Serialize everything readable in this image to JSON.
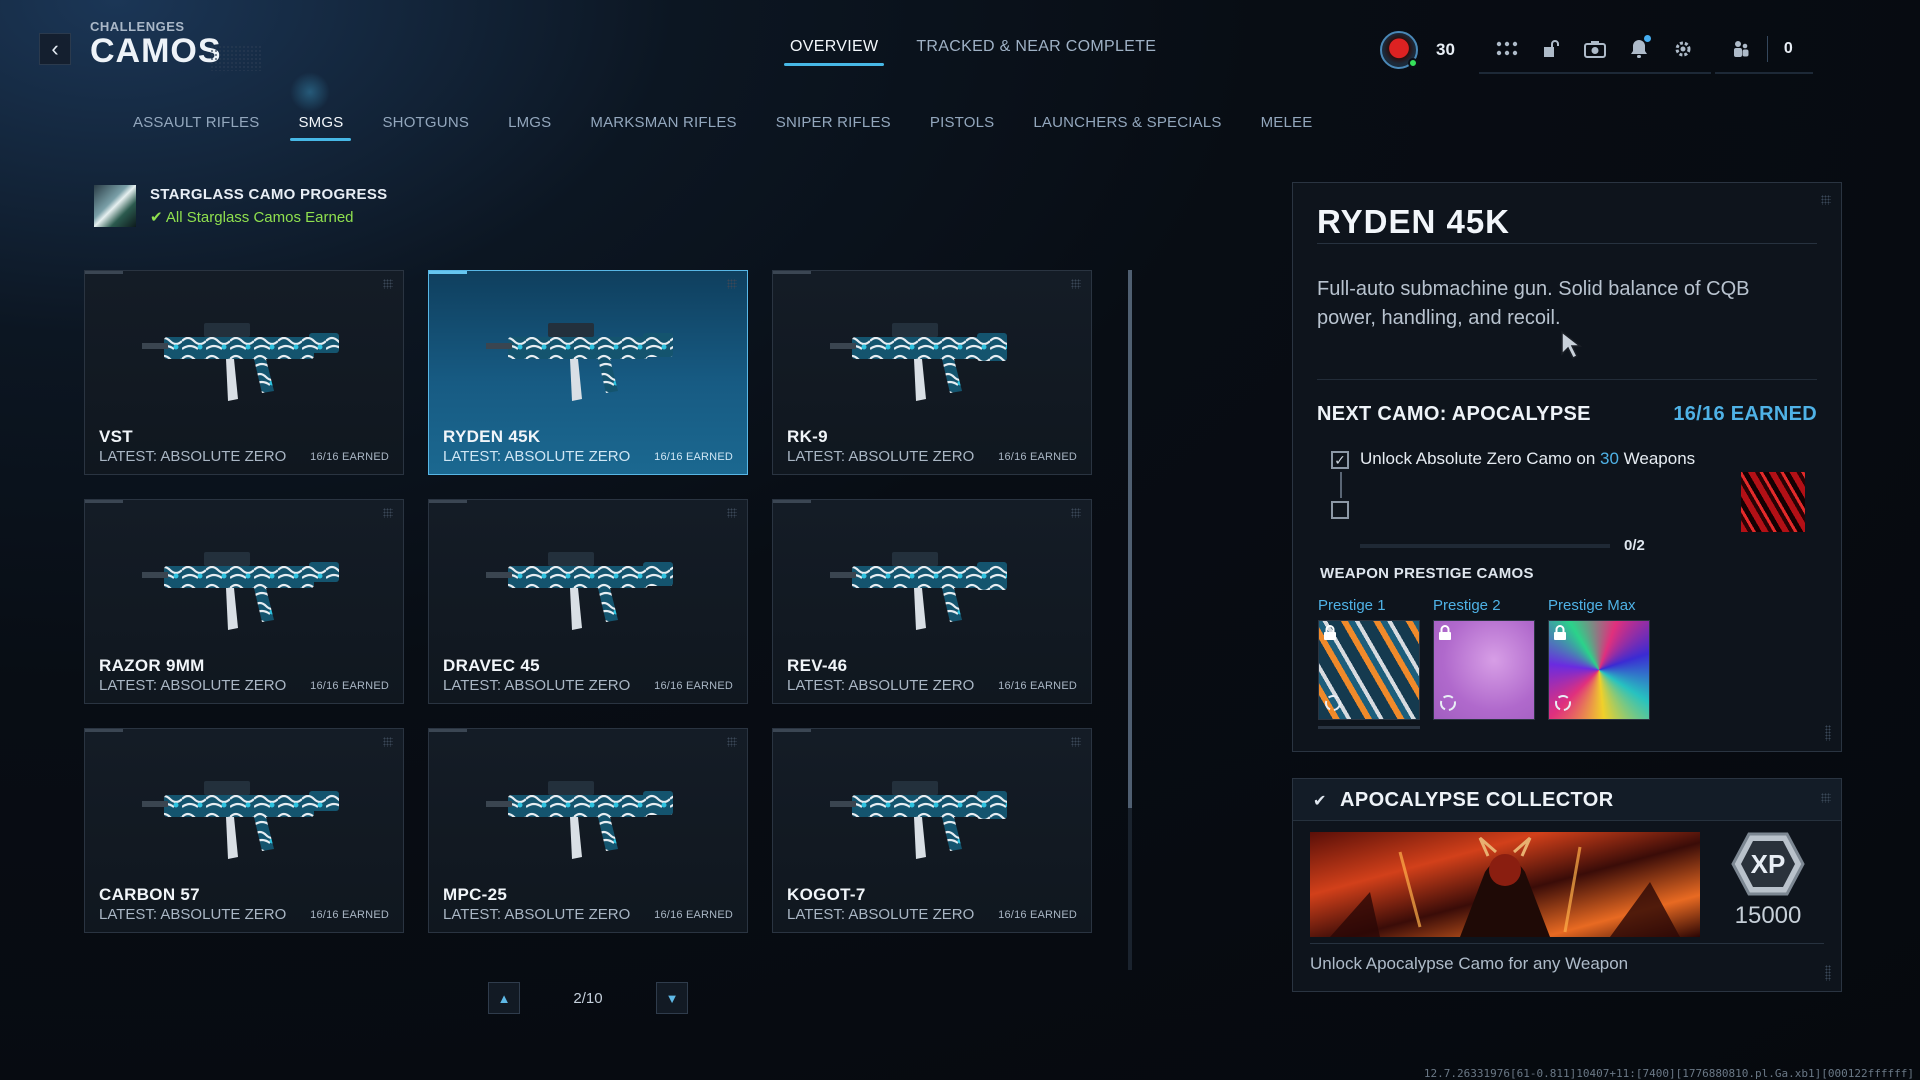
{
  "header": {
    "breadcrumb": "CHALLENGES",
    "title": "CAMOS",
    "top_tabs": [
      {
        "label": "OVERVIEW",
        "active": true
      },
      {
        "label": "TRACKED & NEAR COMPLETE",
        "active": false
      }
    ],
    "level": "30",
    "friends_count": "0",
    "icons": [
      "apps-grid-icon",
      "locker-icon",
      "camera-icon",
      "bell-icon",
      "gear-icon"
    ]
  },
  "categories": [
    {
      "label": "ASSAULT RIFLES",
      "active": false
    },
    {
      "label": "SMGS",
      "active": true
    },
    {
      "label": "SHOTGUNS",
      "active": false
    },
    {
      "label": "LMGS",
      "active": false
    },
    {
      "label": "MARKSMAN RIFLES",
      "active": false
    },
    {
      "label": "SNIPER RIFLES",
      "active": false
    },
    {
      "label": "PISTOLS",
      "active": false
    },
    {
      "label": "LAUNCHERS & SPECIALS",
      "active": false
    },
    {
      "label": "MELEE",
      "active": false
    }
  ],
  "starglass": {
    "title": "STARGLASS CAMO PROGRESS",
    "status": "All Starglass Camos Earned"
  },
  "weapons": [
    {
      "name": "VST",
      "latest": "LATEST: ABSOLUTE ZERO",
      "earned": "16/16 EARNED",
      "selected": false
    },
    {
      "name": "RYDEN 45K",
      "latest": "LATEST: ABSOLUTE ZERO",
      "earned": "16/16 EARNED",
      "selected": true
    },
    {
      "name": "RK-9",
      "latest": "LATEST: ABSOLUTE ZERO",
      "earned": "16/16 EARNED",
      "selected": false
    },
    {
      "name": "RAZOR 9MM",
      "latest": "LATEST: ABSOLUTE ZERO",
      "earned": "16/16 EARNED",
      "selected": false
    },
    {
      "name": "DRAVEC 45",
      "latest": "LATEST: ABSOLUTE ZERO",
      "earned": "16/16 EARNED",
      "selected": false
    },
    {
      "name": "REV-46",
      "latest": "LATEST: ABSOLUTE ZERO",
      "earned": "16/16 EARNED",
      "selected": false
    },
    {
      "name": "CARBON 57",
      "latest": "LATEST: ABSOLUTE ZERO",
      "earned": "16/16 EARNED",
      "selected": false
    },
    {
      "name": "MPC-25",
      "latest": "LATEST: ABSOLUTE ZERO",
      "earned": "16/16 EARNED",
      "selected": false
    },
    {
      "name": "KOGOT-7",
      "latest": "LATEST: ABSOLUTE ZERO",
      "earned": "16/16 EARNED",
      "selected": false
    }
  ],
  "pager": {
    "text": "2/10"
  },
  "detail": {
    "title": "RYDEN 45K",
    "description": "Full-auto submachine gun. Solid balance of CQB power, handling, and recoil.",
    "next_camo": "NEXT CAMO: APOCALYPSE",
    "earned": "16/16 EARNED",
    "requirement": {
      "prefix": "Unlock Absolute Zero Camo on ",
      "highlight": "30",
      "suffix": " Weapons",
      "checked": true
    },
    "progress": {
      "label": "0/2",
      "fraction": 0.0
    },
    "prestige_heading": "WEAPON PRESTIGE CAMOS",
    "prestige": [
      {
        "label": "Prestige 1",
        "locked": true
      },
      {
        "label": "Prestige 2",
        "locked": true
      },
      {
        "label": "Prestige Max",
        "locked": true
      }
    ]
  },
  "collector": {
    "title": "APOCALYPSE COLLECTOR",
    "xp_badge": "XP",
    "xp_value": "15000",
    "description": "Unlock Apocalypse Camo for any Weapon"
  },
  "build_id": "12.7.26331976[61-0.811]10407+11:[7400][1776880810.pl.Ga.xb1][000122ffffff]",
  "colors": {
    "accent": "#4fb2e6",
    "success": "#8fe04e",
    "selected_card": "#175b83"
  }
}
